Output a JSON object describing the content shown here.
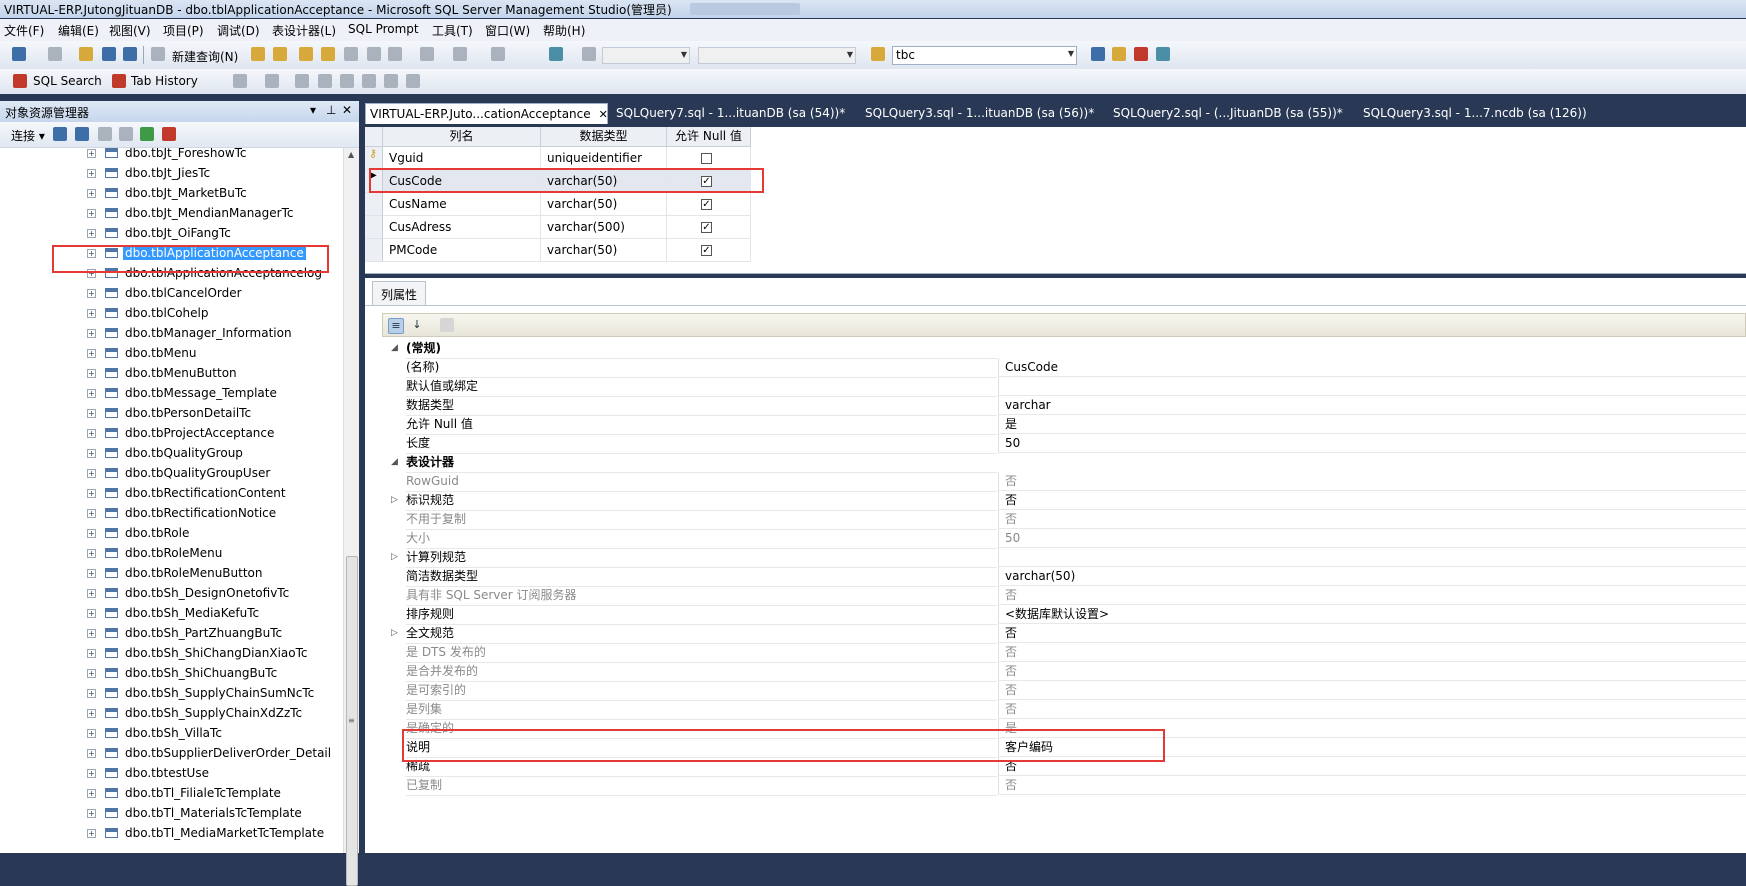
{
  "window": {
    "title": "VIRTUAL-ERP.JutongJituanDB - dbo.tblApplicationAcceptance - Microsoft SQL Server Management Studio(管理员)"
  },
  "menu": [
    "文件(F)",
    "编辑(E)",
    "视图(V)",
    "项目(P)",
    "调试(D)",
    "表设计器(L)",
    "SQL Prompt",
    "工具(T)",
    "窗口(W)",
    "帮助(H)"
  ],
  "toolbar": {
    "new_query": "新建查询(N)",
    "database_combo": "tbc",
    "sql_search": "SQL Search",
    "tab_history": "Tab History"
  },
  "object_explorer": {
    "title": "对象资源管理器",
    "connect": "连接 ▾",
    "items": [
      "dbo.tbJt_ForeshowTc",
      "dbo.tbJt_JiesTc",
      "dbo.tbJt_MarketBuTc",
      "dbo.tbJt_MendianManagerTc",
      "dbo.tbJt_OiFangTc",
      "dbo.tblApplicationAcceptance",
      "dbo.tblApplicationAcceptancelog",
      "dbo.tblCancelOrder",
      "dbo.tblCohelp",
      "dbo.tbManager_Information",
      "dbo.tbMenu",
      "dbo.tbMenuButton",
      "dbo.tbMessage_Template",
      "dbo.tbPersonDetailTc",
      "dbo.tbProjectAcceptance",
      "dbo.tbQualityGroup",
      "dbo.tbQualityGroupUser",
      "dbo.tbRectificationContent",
      "dbo.tbRectificationNotice",
      "dbo.tbRole",
      "dbo.tbRoleMenu",
      "dbo.tbRoleMenuButton",
      "dbo.tbSh_DesignOnetofivTc",
      "dbo.tbSh_MediaKefuTc",
      "dbo.tbSh_PartZhuangBuTc",
      "dbo.tbSh_ShiChangDianXiaoTc",
      "dbo.tbSh_ShiChuangBuTc",
      "dbo.tbSh_SupplyChainSumNcTc",
      "dbo.tbSh_SupplyChainXdZzTc",
      "dbo.tbSh_VillaTc",
      "dbo.tbSupplierDeliverOrder_Detail",
      "dbo.tbtestUse",
      "dbo.tbTl_FilialeTcTemplate",
      "dbo.tbTl_MaterialsTcTemplate",
      "dbo.tbTl_MediaMarketTcTemplate"
    ],
    "selected": "dbo.tblApplicationAcceptance"
  },
  "tabs": [
    {
      "label": "VIRTUAL-ERP.Juto...cationAcceptance",
      "close": "✕"
    },
    {
      "label": "SQLQuery7.sql - 1...ituanDB (sa (54))*"
    },
    {
      "label": "SQLQuery3.sql - 1...ituanDB (sa (56))*"
    },
    {
      "label": "SQLQuery2.sql - (...JituanDB (sa (55))*"
    },
    {
      "label": "SQLQuery3.sql - 1...7.ncdb (sa (126))"
    }
  ],
  "designer": {
    "headers": [
      "列名",
      "数据类型",
      "允许 Null 值"
    ],
    "rows": [
      {
        "name": "Vguid",
        "type": "uniqueidentifier",
        "nullable": false,
        "key": true
      },
      {
        "name": "CusCode",
        "type": "varchar(50)",
        "nullable": true,
        "current": true
      },
      {
        "name": "CusName",
        "type": "varchar(50)",
        "nullable": true
      },
      {
        "name": "CusAdress",
        "type": "varchar(500)",
        "nullable": true
      },
      {
        "name": "PMCode",
        "type": "varchar(50)",
        "nullable": true
      }
    ]
  },
  "properties": {
    "tab": "列属性",
    "rows": [
      {
        "n": "(常规)",
        "v": "",
        "cat": true
      },
      {
        "n": "(名称)",
        "v": "CusCode"
      },
      {
        "n": "默认值或绑定",
        "v": ""
      },
      {
        "n": "数据类型",
        "v": "varchar"
      },
      {
        "n": "允许 Null 值",
        "v": "是"
      },
      {
        "n": "长度",
        "v": "50"
      },
      {
        "n": "表设计器",
        "v": "",
        "cat": true
      },
      {
        "n": "RowGuid",
        "v": "否",
        "dim": true
      },
      {
        "n": "标识规范",
        "v": "否",
        "exp": true
      },
      {
        "n": "不用于复制",
        "v": "否",
        "dim": true
      },
      {
        "n": "大小",
        "v": "50",
        "dim": true
      },
      {
        "n": "计算列规范",
        "v": "",
        "exp": true
      },
      {
        "n": "简洁数据类型",
        "v": "varchar(50)"
      },
      {
        "n": "具有非 SQL Server 订阅服务器",
        "v": "否",
        "dim": true
      },
      {
        "n": "排序规则",
        "v": "<数据库默认设置>"
      },
      {
        "n": "全文规范",
        "v": "否",
        "exp": true
      },
      {
        "n": "是 DTS 发布的",
        "v": "否",
        "dim": true
      },
      {
        "n": "是合并发布的",
        "v": "否",
        "dim": true
      },
      {
        "n": "是可索引的",
        "v": "否",
        "dim": true
      },
      {
        "n": "是列集",
        "v": "否",
        "dim": true
      },
      {
        "n": "是确定的",
        "v": "是",
        "dim": true
      },
      {
        "n": "说明",
        "v": "客户编码"
      },
      {
        "n": "稀疏",
        "v": "否"
      },
      {
        "n": "已复制",
        "v": "否",
        "dim": true
      }
    ]
  }
}
